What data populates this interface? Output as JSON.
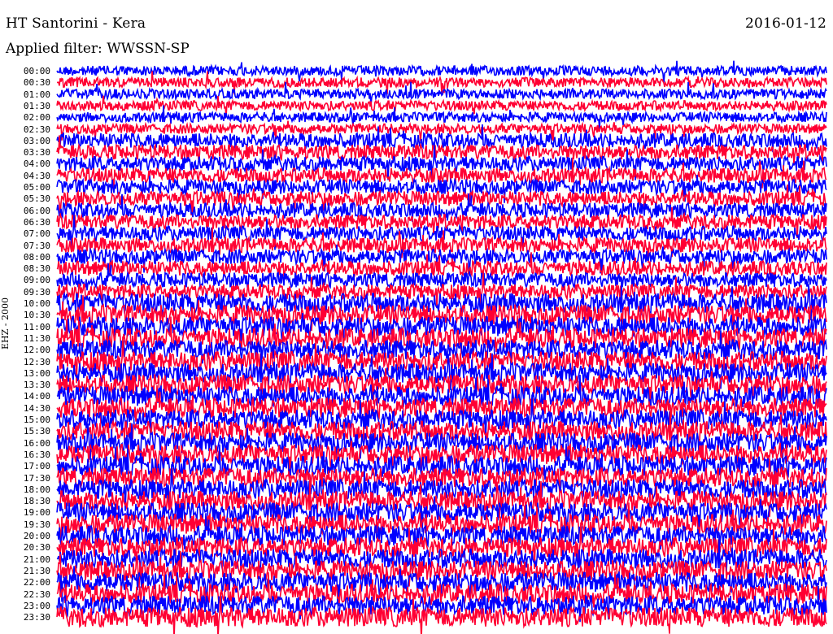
{
  "header": {
    "title": "HT Santorini - Kera",
    "date": "2016-01-12",
    "filter": "Applied filter: WWSSN-SP"
  },
  "chart_data": {
    "type": "line",
    "title": "HT Santorini - Kera",
    "ylabel": "EHZ - 2000",
    "xlabel": "",
    "series_colors": [
      "#0000ff",
      "#ff0033"
    ],
    "rows": [
      "00:00",
      "00:30",
      "01:00",
      "01:30",
      "02:00",
      "02:30",
      "03:00",
      "03:30",
      "04:00",
      "04:30",
      "05:00",
      "05:30",
      "06:00",
      "06:30",
      "07:00",
      "07:30",
      "08:00",
      "08:30",
      "09:00",
      "09:30",
      "10:00",
      "10:30",
      "11:00",
      "11:30",
      "12:00",
      "12:30",
      "13:00",
      "13:30",
      "14:00",
      "14:30",
      "15:00",
      "15:30",
      "16:00",
      "16:30",
      "17:00",
      "17:30",
      "18:00",
      "18:30",
      "19:00",
      "19:30",
      "20:00",
      "20:30",
      "21:00",
      "21:30",
      "22:00",
      "22:30",
      "23:00",
      "23:30"
    ],
    "grid": false,
    "legend": "none"
  }
}
